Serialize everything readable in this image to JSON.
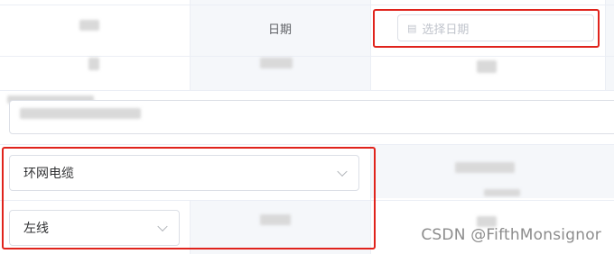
{
  "row1": {
    "date_label": "日期",
    "date_placeholder": "选择日期"
  },
  "selects": {
    "type_value": "环网电缆",
    "line_value": "左线"
  },
  "watermark": "CSDN @FifthMonsignor",
  "colors": {
    "highlight_border": "#e0231c",
    "cell_gray": "#f5f7fa",
    "border": "#dcdfe6",
    "placeholder": "#c0c4cc"
  },
  "icons": {
    "date_icon": "calendar-icon",
    "select_icon": "chevron-down-icon"
  }
}
